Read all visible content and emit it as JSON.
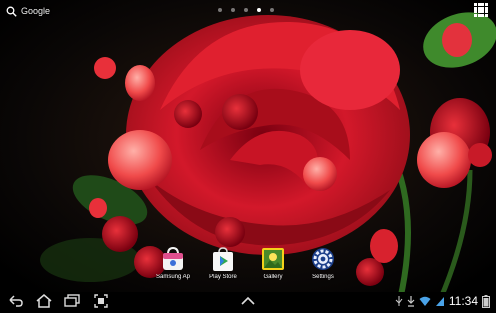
{
  "search": {
    "label": "Google"
  },
  "home_pages": {
    "count": 5,
    "active_index": 3
  },
  "dock_apps": [
    {
      "label": "Samsung Ap",
      "icon": "samsung-apps-icon"
    },
    {
      "label": "Play Store",
      "icon": "play-store-icon"
    },
    {
      "label": "Gallery",
      "icon": "gallery-icon"
    },
    {
      "label": "Settings",
      "icon": "settings-gear-icon"
    }
  ],
  "nav": {
    "back": "back-icon",
    "home": "home-icon",
    "recents": "recent-apps-icon",
    "screenshot": "screenshot-icon",
    "up": "chevron-up-icon"
  },
  "status": {
    "time": "11:34",
    "icons": [
      "usb-icon",
      "download-icon",
      "wifi-icon",
      "signal-icon"
    ]
  },
  "colors": {
    "rose": "#c8102e",
    "leaf": "#3f7d2a",
    "background": "#050505"
  }
}
